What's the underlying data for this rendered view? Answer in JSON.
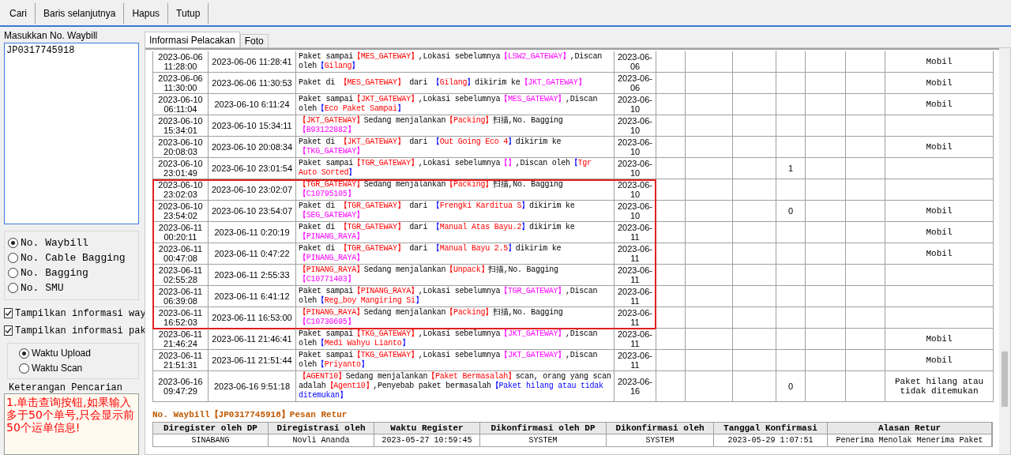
{
  "toolbar": {
    "buttons": [
      "Cari",
      "Baris selanjutnya",
      "Hapus",
      "Tutup"
    ]
  },
  "search_panel": {
    "label": "Masukkan No. Waybill",
    "value": "JP0317745918",
    "number_types": [
      {
        "label": "No. Waybill",
        "selected": true
      },
      {
        "label": "No. Cable Bagging",
        "selected": false
      },
      {
        "label": "No. Bagging",
        "selected": false
      },
      {
        "label": "No. SMU",
        "selected": false
      }
    ],
    "options": [
      {
        "label": "Tampilkan informasi way",
        "checked": true
      },
      {
        "label": "Tampilkan informasi pak",
        "checked": true
      }
    ],
    "time_types": [
      {
        "label": "Waktu Upload",
        "selected": true
      },
      {
        "label": "Waktu Scan",
        "selected": false
      }
    ],
    "notes": {
      "title": "Keterangan Pencarian",
      "value": "1.单击查询按钮,如果输入多于50个单号,只会显示前50个运单信息!"
    }
  },
  "tabs": [
    {
      "label": "Informasi Pelacakan",
      "selected": true
    },
    {
      "label": "Foto",
      "selected": false
    }
  ],
  "rows": [
    {
      "column_1": "2023-06-06 11:28:00",
      "column_2": "2023-06-06 11:28:41",
      "column_3": [
        {
          "text": "Paket sampai"
        },
        {
          "text": "【MES_GATEWAY】",
          "kind": "site"
        },
        {
          "text": ",Lokasi sebelumnya"
        },
        {
          "text": "【LSW2_GATEWAY】",
          "kind": "code"
        },
        {
          "text": ",Discan oleh"
        },
        {
          "text": "【",
          "kind": "bracket"
        },
        {
          "text": "Gilang",
          "kind": "name"
        },
        {
          "text": "】",
          "kind": "bracket"
        }
      ],
      "column_4": "2023-06-06",
      "column_11": "Mobil",
      "marked": false
    },
    {
      "column_1": "2023-06-06 11:30:00",
      "column_2": "2023-06-06 11:30:53",
      "column_3": [
        {
          "text": "Paket di "
        },
        {
          "text": "【MES_GATEWAY】",
          "kind": "site"
        },
        {
          "text": " dari "
        },
        {
          "text": "【",
          "kind": "bracket"
        },
        {
          "text": "Gilang",
          "kind": "name"
        },
        {
          "text": "】",
          "kind": "bracket"
        },
        {
          "text": "dikirim ke"
        },
        {
          "text": "【JKT_GATEWAY】",
          "kind": "code"
        }
      ],
      "column_4": "2023-06-06",
      "column_11": "Mobil",
      "marked": false
    },
    {
      "column_1": "2023-06-10 06:11:04",
      "column_2": "2023-06-10 6:11:24",
      "column_3": [
        {
          "text": "Paket sampai"
        },
        {
          "text": "【JKT_GATEWAY】",
          "kind": "site"
        },
        {
          "text": ",Lokasi sebelumnya"
        },
        {
          "text": "【MES_GATEWAY】",
          "kind": "code"
        },
        {
          "text": ",Discan oleh"
        },
        {
          "text": "【",
          "kind": "bracket"
        },
        {
          "text": "Eco Paket Sampai",
          "kind": "name"
        },
        {
          "text": "】",
          "kind": "bracket"
        }
      ],
      "column_4": "2023-06-10",
      "column_11": "Mobil",
      "marked": false
    },
    {
      "column_1": "2023-06-10 15:34:01",
      "column_2": "2023-06-10 15:34:11",
      "column_3": [
        {
          "text": "【JKT_GATEWAY】",
          "kind": "site"
        },
        {
          "text": "Sedang menjalankan"
        },
        {
          "text": "【Packing】",
          "kind": "site"
        },
        {
          "text": "扫描,No. Bagging"
        },
        {
          "text": "【B93122882】",
          "kind": "code"
        }
      ],
      "column_4": "2023-06-10",
      "marked": false
    },
    {
      "column_1": "2023-06-10 20:08:03",
      "column_2": "2023-06-10 20:08:34",
      "column_3": [
        {
          "text": "Paket di "
        },
        {
          "text": "【JKT_GATEWAY】",
          "kind": "site"
        },
        {
          "text": " dari "
        },
        {
          "text": "【",
          "kind": "bracket"
        },
        {
          "text": "Out Going Eco 4",
          "kind": "name"
        },
        {
          "text": "】",
          "kind": "bracket"
        },
        {
          "text": "dikirim ke"
        },
        {
          "text": "【TKG_GATEWAY】",
          "kind": "code"
        }
      ],
      "column_4": "2023-06-10",
      "column_11": "Mobil",
      "marked": false
    },
    {
      "column_1": "2023-06-10 23:01:49",
      "column_2": "2023-06-10 23:01:54",
      "column_3": [
        {
          "text": "Paket sampai"
        },
        {
          "text": "【TGR_GATEWAY】",
          "kind": "site"
        },
        {
          "text": ",Lokasi sebelumnya"
        },
        {
          "text": "【】",
          "kind": "code"
        },
        {
          "text": ",Discan oleh"
        },
        {
          "text": "【",
          "kind": "bracket"
        },
        {
          "text": "Tgr Auto Sorted",
          "kind": "name"
        },
        {
          "text": "】",
          "kind": "bracket"
        }
      ],
      "column_4": "2023-06-10",
      "column_8": "1",
      "marked": false
    },
    {
      "column_1": "2023-06-10 23:02:03",
      "column_2": "2023-06-10 23:02:07",
      "column_3": [
        {
          "text": "【TGR_GATEWAY】",
          "kind": "site"
        },
        {
          "text": "Sedang menjalankan"
        },
        {
          "text": "【Packing】",
          "kind": "site"
        },
        {
          "text": "扫描,No. Bagging"
        },
        {
          "text": "【C10795105】",
          "kind": "code"
        }
      ],
      "column_4": "2023-06-10",
      "marked": true
    },
    {
      "column_1": "2023-06-10 23:54:02",
      "column_2": "2023-06-10 23:54:07",
      "column_3": [
        {
          "text": "Paket di "
        },
        {
          "text": "【TGR_GATEWAY】",
          "kind": "site"
        },
        {
          "text": " dari "
        },
        {
          "text": "【",
          "kind": "bracket"
        },
        {
          "text": "Frengki Karditua S",
          "kind": "name"
        },
        {
          "text": "】",
          "kind": "bracket"
        },
        {
          "text": "dikirim ke"
        },
        {
          "text": "【SEG_GATEWAY】",
          "kind": "code"
        }
      ],
      "column_4": "2023-06-10",
      "column_8": "0",
      "column_11": "Mobil",
      "marked": true
    },
    {
      "column_1": "2023-06-11 00:20:11",
      "column_2": "2023-06-11 0:20:19",
      "column_3": [
        {
          "text": "Paket di "
        },
        {
          "text": "【TGR_GATEWAY】",
          "kind": "site"
        },
        {
          "text": " dari "
        },
        {
          "text": "【",
          "kind": "bracket"
        },
        {
          "text": "Manual Atas Bayu.2",
          "kind": "name"
        },
        {
          "text": "】",
          "kind": "bracket"
        },
        {
          "text": "dikirim ke"
        },
        {
          "text": "【PINANG_RAYA】",
          "kind": "code"
        }
      ],
      "column_4": "2023-06-11",
      "column_11": "Mobil",
      "marked": true
    },
    {
      "column_1": "2023-06-11 00:47:08",
      "column_2": "2023-06-11 0:47:22",
      "column_3": [
        {
          "text": "Paket di "
        },
        {
          "text": "【TGR_GATEWAY】",
          "kind": "site"
        },
        {
          "text": " dari "
        },
        {
          "text": "【",
          "kind": "bracket"
        },
        {
          "text": "Manual Bayu 2.5",
          "kind": "name"
        },
        {
          "text": "】",
          "kind": "bracket"
        },
        {
          "text": "dikirim ke"
        },
        {
          "text": "【PINANG_RAYA】",
          "kind": "code"
        }
      ],
      "column_4": "2023-06-11",
      "column_11": "Mobil",
      "marked": true
    },
    {
      "column_1": "2023-06-11 02:55:28",
      "column_2": "2023-06-11 2:55:33",
      "column_3": [
        {
          "text": "【PINANG_RAYA】",
          "kind": "site"
        },
        {
          "text": "Sedang menjalankan"
        },
        {
          "text": "【Unpack】",
          "kind": "site"
        },
        {
          "text": "扫描,No. Bagging"
        },
        {
          "text": "【C10771403】",
          "kind": "code"
        }
      ],
      "column_4": "2023-06-11",
      "marked": true
    },
    {
      "column_1": "2023-06-11 06:39:08",
      "column_2": "2023-06-11 6:41:12",
      "column_3": [
        {
          "text": "Paket sampai"
        },
        {
          "text": "【PINANG_RAYA】",
          "kind": "site"
        },
        {
          "text": ",Lokasi sebelumnya"
        },
        {
          "text": "【TGR_GATEWAY】",
          "kind": "code"
        },
        {
          "text": ",Discan oleh"
        },
        {
          "text": "【",
          "kind": "bracket"
        },
        {
          "text": "Reg_boy Mangiring Si",
          "kind": "name"
        },
        {
          "text": "】",
          "kind": "bracket"
        }
      ],
      "column_4": "2023-06-11",
      "marked": true
    },
    {
      "column_1": "2023-06-11 16:52:03",
      "column_2": "2023-06-11 16:53:00",
      "column_3": [
        {
          "text": "【PINANG_RAYA】",
          "kind": "site"
        },
        {
          "text": "Sedang menjalankan"
        },
        {
          "text": "【Packing】",
          "kind": "site"
        },
        {
          "text": "扫描,No. Bagging"
        },
        {
          "text": "【C10730695】",
          "kind": "code"
        }
      ],
      "column_4": "2023-06-11",
      "marked": true
    },
    {
      "column_1": "2023-06-11 21:46:24",
      "column_2": "2023-06-11 21:46:41",
      "column_3": [
        {
          "text": "Paket sampai"
        },
        {
          "text": "【TKG_GATEWAY】",
          "kind": "site"
        },
        {
          "text": ",Lokasi sebelumnya"
        },
        {
          "text": "【JKT_GATEWAY】",
          "kind": "code"
        },
        {
          "text": ",Discan oleh"
        },
        {
          "text": "【",
          "kind": "bracket"
        },
        {
          "text": "Medi Wahyu Lianto",
          "kind": "name"
        },
        {
          "text": "】",
          "kind": "bracket"
        }
      ],
      "column_4": "2023-06-11",
      "column_11": "Mobil",
      "marked": false
    },
    {
      "column_1": "2023-06-11 21:51:31",
      "column_2": "2023-06-11 21:51:44",
      "column_3": [
        {
          "text": "Paket sampai"
        },
        {
          "text": "【TKG_GATEWAY】",
          "kind": "site"
        },
        {
          "text": ",Lokasi sebelumnya"
        },
        {
          "text": "【JKT_GATEWAY】",
          "kind": "code"
        },
        {
          "text": ",Discan oleh"
        },
        {
          "text": "【",
          "kind": "bracket"
        },
        {
          "text": "Priyanto",
          "kind": "name"
        },
        {
          "text": "】",
          "kind": "bracket"
        }
      ],
      "column_4": "2023-06-11",
      "column_11": "Mobil",
      "marked": false
    },
    {
      "column_1": "2023-06-16 09:47:29",
      "column_2": "2023-06-16 9:51:18",
      "column_3": [
        {
          "text": "【AGENT10】",
          "kind": "site"
        },
        {
          "text": "Sedang menjalankan"
        },
        {
          "text": "【Paket Bermasalah】",
          "kind": "site"
        },
        {
          "text": "scan, orang yang scan adalah"
        },
        {
          "text": "【Agent10】",
          "kind": "site"
        },
        {
          "text": ",Penyebab paket bermasalah"
        },
        {
          "text": "【Paket hilang atau tidak ditemukan】",
          "kind": "reason"
        }
      ],
      "column_4": "2023-06-16",
      "column_8": "0",
      "column_11": "Paket hilang atau tidak ditemukan",
      "marked": false
    }
  ],
  "return_info": {
    "title": "No. Waybill【JP0317745918】Pesan Retur",
    "columns": [
      "Diregister oleh DP",
      "Diregistrasi oleh",
      "Waktu Register",
      "Dikonfirmasi oleh DP",
      "Dikonfirmasi oleh",
      "Tanggal Konfirmasi",
      "Alasan Retur"
    ],
    "rows": [
      [
        "SINABANG",
        "Novli Ananda",
        "2023-05-27 10:59:45",
        "SYSTEM",
        "SYSTEM",
        "2023-05-29 1:07:51",
        "Penerima Menolak Menerima Paket"
      ]
    ]
  }
}
